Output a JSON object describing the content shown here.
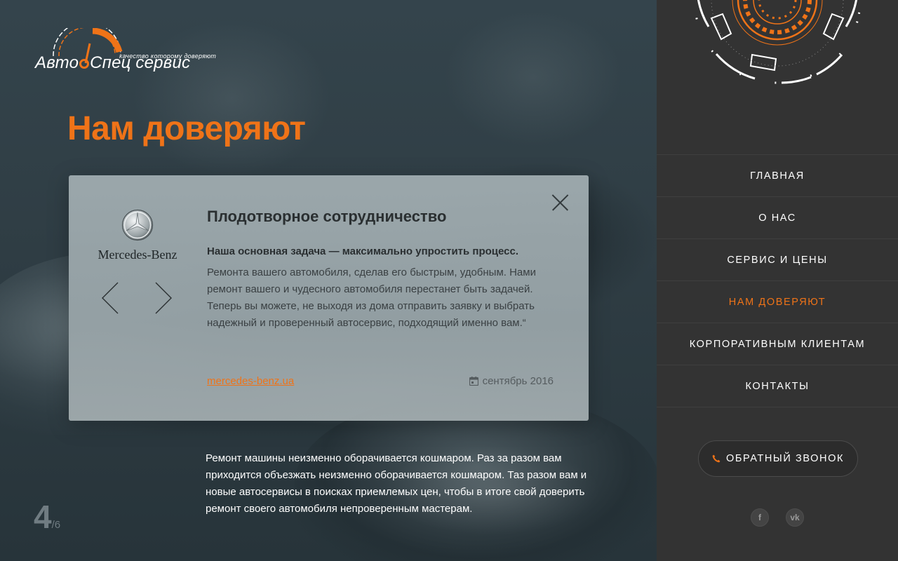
{
  "logo": {
    "part1": "Авто",
    "part2": "Спец сервис",
    "tagline": "качество которому доверяют"
  },
  "page": {
    "title": "Нам доверяют"
  },
  "card": {
    "brand_name": "Mercedes-Benz",
    "heading": "Плодотворное сотрудничество",
    "lead": "Наша основная задача — максимально упростить процесс.",
    "body": "Ремонта вашего автомобиля, сделав его быстрым, удобным. Нами ремонт вашего и чудесного автомобиля перестанет быть задачей. Теперь вы можете, не выходя из дома отправить заявку и выбрать надежный и проверенный автосервис, подходящий именно вам.“",
    "link": "mercedes-benz.ua",
    "date": "сентябрь 2016",
    "icons": {
      "close": "close-icon",
      "prev": "chevron-left-icon",
      "next": "chevron-right-icon",
      "calendar": "calendar-icon"
    }
  },
  "below_text": "Ремонт машины неизменно оборачивается кошмаром. Раз за разом вам приходится объезжать неизменно оборачивается кошмаром. Таз разом вам и новые автосервисы в поисках приемлемых цен, чтобы в итоге свой доверить ремонт своего автомобиля непроверенным мастерам.",
  "pager": {
    "current": "4",
    "total": "/6"
  },
  "sidebar": {
    "nav": [
      {
        "label": "ГЛАВНАЯ",
        "active": false
      },
      {
        "label": "О НАС",
        "active": false
      },
      {
        "label": "СЕРВИС И ЦЕНЫ",
        "active": false
      },
      {
        "label": "НАМ ДОВЕРЯЮТ",
        "active": true
      },
      {
        "label": "КОРПОРАТИВНЫМ КЛИЕНТАМ",
        "active": false
      },
      {
        "label": "КОНТАКТЫ",
        "active": false
      }
    ],
    "callback_label": "ОБРАТНЫЙ ЗВОНОК",
    "socials": [
      {
        "icon": "facebook-icon",
        "glyph": "f"
      },
      {
        "icon": "vk-icon",
        "glyph": "vk"
      }
    ]
  },
  "colors": {
    "accent": "#ef7318",
    "sidebar_bg": "#333333",
    "hero_bg": "#2e3a41",
    "card_bg": "#9eaaae"
  }
}
